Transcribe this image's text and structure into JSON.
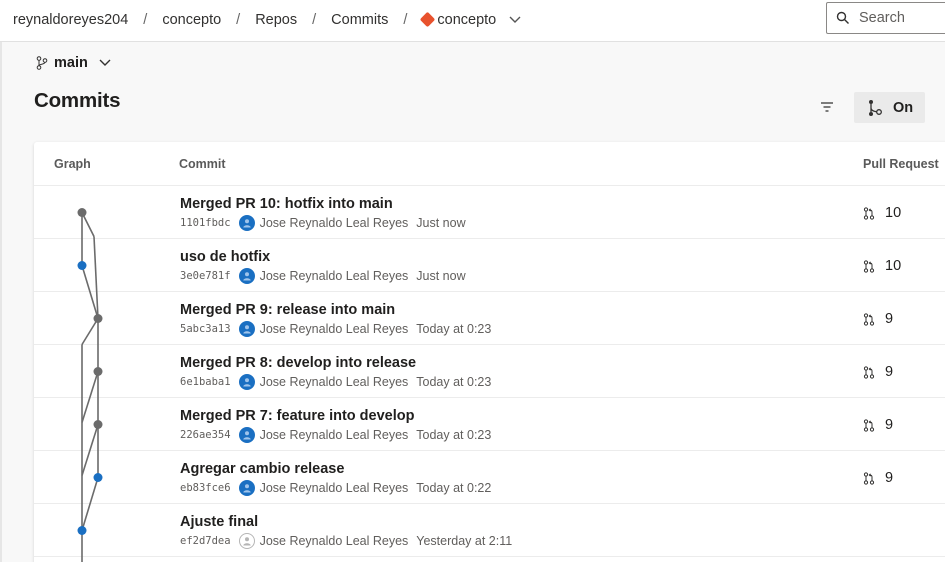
{
  "breadcrumb": {
    "items": [
      "reynaldoreyes204",
      "concepto",
      "Repos",
      "Commits"
    ],
    "separator": "/",
    "repo": "concepto"
  },
  "search": {
    "placeholder": "Search"
  },
  "branch": {
    "name": "main"
  },
  "page": {
    "title": "Commits"
  },
  "graph_toggle": {
    "label": "On"
  },
  "table": {
    "headers": {
      "graph": "Graph",
      "commit": "Commit",
      "pull_request": "Pull Request"
    },
    "rows": [
      {
        "message": "Merged PR 10: hotfix into main",
        "hash": "1101fbdc",
        "author": "Jose Reynaldo Leal Reyes",
        "time": "Just now",
        "pr": "10",
        "avatar": "blue",
        "node": "gray"
      },
      {
        "message": "uso de hotfix",
        "hash": "3e0e781f",
        "author": "Jose Reynaldo Leal Reyes",
        "time": "Just now",
        "pr": "10",
        "avatar": "blue",
        "node": "blue"
      },
      {
        "message": "Merged PR 9: release into main",
        "hash": "5abc3a13",
        "author": "Jose Reynaldo Leal Reyes",
        "time": "Today at 0:23",
        "pr": "9",
        "avatar": "blue",
        "node": "gray"
      },
      {
        "message": "Merged PR 8: develop into release",
        "hash": "6e1baba1",
        "author": "Jose Reynaldo Leal Reyes",
        "time": "Today at 0:23",
        "pr": "9",
        "avatar": "blue",
        "node": "gray"
      },
      {
        "message": "Merged PR 7: feature into develop",
        "hash": "226ae354",
        "author": "Jose Reynaldo Leal Reyes",
        "time": "Today at 0:23",
        "pr": "9",
        "avatar": "blue",
        "node": "gray"
      },
      {
        "message": "Agregar cambio release",
        "hash": "eb83fce6",
        "author": "Jose Reynaldo Leal Reyes",
        "time": "Today at 0:22",
        "pr": "9",
        "avatar": "blue",
        "node": "blue"
      },
      {
        "message": "Ajuste final",
        "hash": "ef2d7dea",
        "author": "Jose Reynaldo Leal Reyes",
        "time": "Yesterday at 2:11",
        "pr": "",
        "avatar": "gray",
        "node": "blue"
      }
    ]
  },
  "colors": {
    "node_gray": "#6b6b6b",
    "node_blue": "#1a6fc2",
    "line": "#6b6b6b",
    "repo_icon": "#e8522d"
  }
}
